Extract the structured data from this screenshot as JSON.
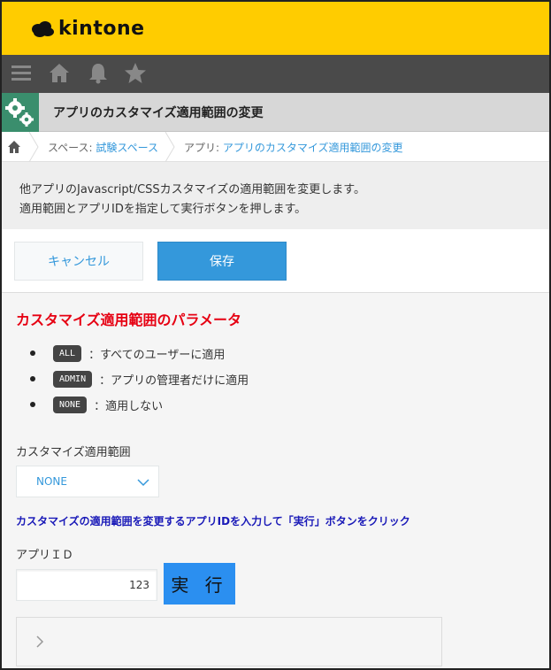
{
  "brand": {
    "name": "kintone",
    "color": "#ffcc00"
  },
  "nav": {
    "icons": [
      "menu-icon",
      "home-icon",
      "bell-icon",
      "star-icon"
    ]
  },
  "app": {
    "title": "アプリのカスタマイズ適用範囲の変更",
    "icon": "gears-icon"
  },
  "breadcrumb": {
    "space_prefix": "スペース: ",
    "space_name": "試験スペース",
    "app_prefix": "アプリ: ",
    "app_name": "アプリのカスタマイズ適用範囲の変更"
  },
  "description": {
    "line1": "他アプリのJavascript/CSSカスタマイズの適用範囲を変更します。",
    "line2": "適用範囲とアプリIDを指定して実行ボタンを押します。"
  },
  "actions": {
    "cancel_label": "キャンセル",
    "save_label": "保存"
  },
  "params": {
    "title": "カスタマイズ適用範囲のパラメータ",
    "items": [
      {
        "tag": "ALL",
        "text": "：すべてのユーザーに適用"
      },
      {
        "tag": "ADMIN",
        "text": "：アプリの管理者だけに適用"
      },
      {
        "tag": "NONE",
        "text": "：適用しない"
      }
    ]
  },
  "scope": {
    "label": "カスタマイズ適用範囲",
    "selected": "NONE"
  },
  "instruction": "カスタマイズの適用範囲を変更するアプリIDを入力して「実行」ボタンをクリック",
  "app_id": {
    "label": "アプリＩＤ",
    "value": "123"
  },
  "run_label": "実 行",
  "colors": {
    "accent": "#3498db",
    "warning": "#e60012",
    "instruction": "#1a1ab8",
    "run": "#2b8ff0"
  }
}
